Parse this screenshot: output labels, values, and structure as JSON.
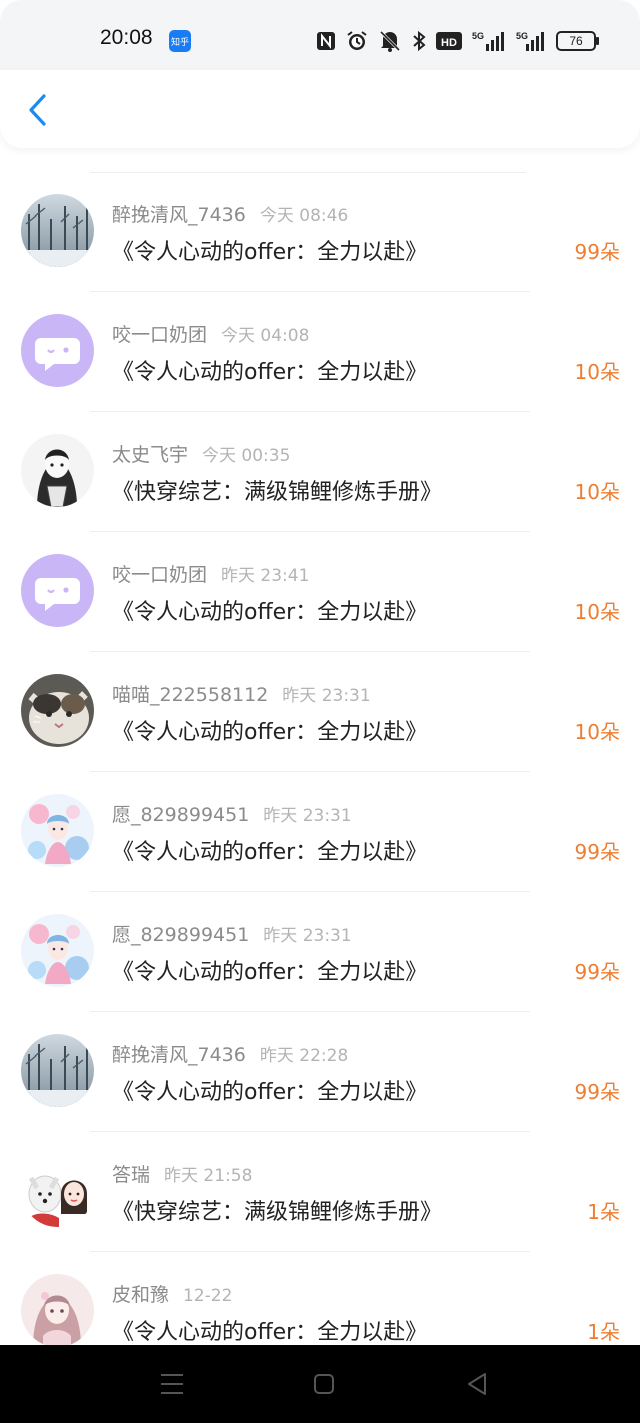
{
  "status_bar": {
    "time": "20:08",
    "app_badge": "知乎",
    "icons": [
      "nfc-icon",
      "alarm-icon",
      "mute-icon",
      "bluetooth-icon",
      "hd-icon",
      "signal-5g-icon",
      "signal-5g-icon",
      "battery-icon"
    ],
    "battery_level": "76",
    "hd_label": "HD",
    "net1_label": "5G",
    "net2_label": "5G"
  },
  "header": {
    "back_icon": "chevron-left-icon"
  },
  "colors": {
    "accent": "#1a8cf0",
    "gift_count": "#ee7d2f",
    "meta": "#8b8b8b",
    "time": "#b4b4b4",
    "lilac": "#c9b6f7"
  },
  "records": [
    {
      "user": "醉挽清风_7436",
      "time": "今天 08:46",
      "book": "《令人心动的offer：全力以赴》",
      "gift": "99朵",
      "avatar": "snow-forest"
    },
    {
      "user": "咬一口奶团",
      "time": "今天 04:08",
      "book": "《令人心动的offer：全力以赴》",
      "gift": "10朵",
      "avatar": "chat-bubble"
    },
    {
      "user": "太史飞宇",
      "time": "今天 00:35",
      "book": "《快穿综艺：满级锦鲤修炼手册》",
      "gift": "10朵",
      "avatar": "sketch-girl"
    },
    {
      "user": "咬一口奶团",
      "time": "昨天 23:41",
      "book": "《令人心动的offer：全力以赴》",
      "gift": "10朵",
      "avatar": "chat-bubble"
    },
    {
      "user": "喵喵_222558112",
      "time": "昨天 23:31",
      "book": "《令人心动的offer：全力以赴》",
      "gift": "10朵",
      "avatar": "cat"
    },
    {
      "user": "愿_829899451",
      "time": "昨天 23:31",
      "book": "《令人心动的offer：全力以赴》",
      "gift": "99朵",
      "avatar": "flower-girl"
    },
    {
      "user": "愿_829899451",
      "time": "昨天 23:31",
      "book": "《令人心动的offer：全力以赴》",
      "gift": "99朵",
      "avatar": "flower-girl"
    },
    {
      "user": "醉挽清风_7436",
      "time": "昨天 22:28",
      "book": "《令人心动的offer：全力以赴》",
      "gift": "99朵",
      "avatar": "snow-forest"
    },
    {
      "user": "答瑞",
      "time": "昨天 21:58",
      "book": "《快穿综艺：满级锦鲤修炼手册》",
      "gift": "1朵",
      "avatar": "girl-dog"
    },
    {
      "user": "皮和豫",
      "time": "12-22",
      "book": "《令人心动的offer：全力以赴》",
      "gift": "1朵",
      "avatar": "anime-girl"
    }
  ],
  "nav_bar": {
    "buttons": [
      "menu-icon",
      "home-icon",
      "back-triangle-icon"
    ]
  }
}
